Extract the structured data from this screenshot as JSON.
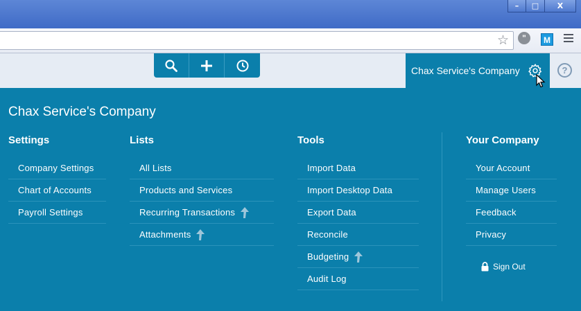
{
  "window": {
    "minimize": "–",
    "maximize": "□",
    "close": "X"
  },
  "browser": {
    "extension_1": "\"",
    "extension_2": "M"
  },
  "header": {
    "company_name": "Chax Service's Company",
    "help": "?"
  },
  "panel": {
    "title": "Chax Service's Company",
    "columns": [
      {
        "heading": "Settings",
        "items": [
          "Company Settings",
          "Chart of Accounts",
          "Payroll Settings"
        ]
      },
      {
        "heading": "Lists",
        "items": [
          "All Lists",
          "Products and Services",
          "Recurring Transactions",
          "Attachments"
        ]
      },
      {
        "heading": "Tools",
        "items": [
          "Import Data",
          "Import Desktop Data",
          "Export Data",
          "Reconcile",
          "Budgeting",
          "Audit Log"
        ]
      },
      {
        "heading": "Your Company",
        "items": [
          "Your Account",
          "Manage Users",
          "Feedback",
          "Privacy"
        ]
      }
    ],
    "sign_out": "Sign Out"
  },
  "icons": {
    "search": "search-icon",
    "add": "plus-icon",
    "recent": "clock-icon",
    "settings": "gear-icon",
    "upgrade": "up-arrow-icon",
    "lock": "lock-icon"
  },
  "colors": {
    "brand": "#0b7fab",
    "header_bg": "#e6ecf4",
    "upgrade_arrow": "#9ec6da"
  }
}
